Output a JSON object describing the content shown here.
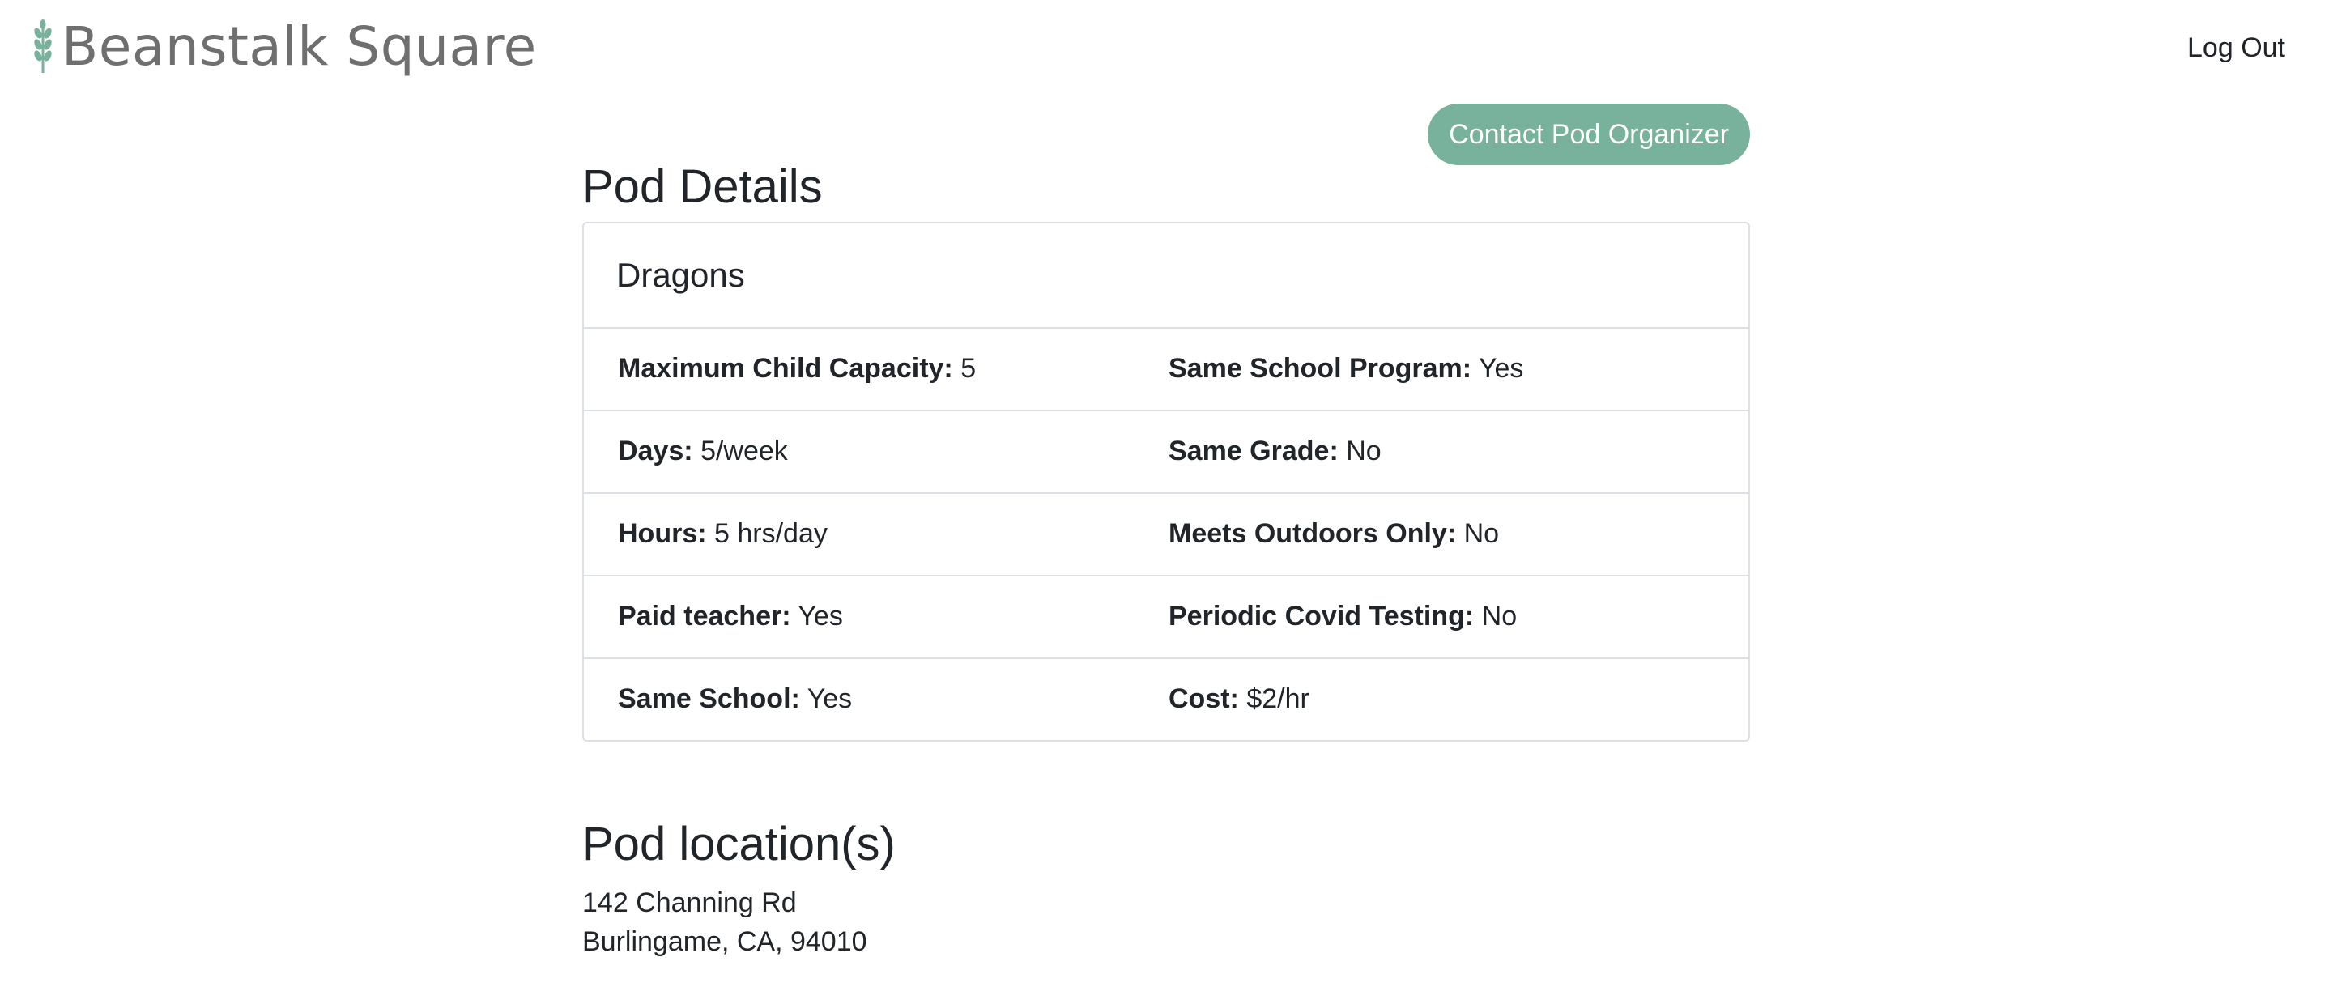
{
  "header": {
    "brand": "Beanstalk Square",
    "logout_label": "Log Out"
  },
  "actions": {
    "contact_label": "Contact Pod Organizer"
  },
  "pod_details": {
    "title": "Pod Details",
    "pod_name": "Dragons",
    "rows": [
      {
        "left": {
          "label": "Maximum Child Capacity:",
          "value": "5"
        },
        "right": {
          "label": "Same School Program:",
          "value": "Yes"
        }
      },
      {
        "left": {
          "label": "Days:",
          "value": "5/week"
        },
        "right": {
          "label": "Same Grade:",
          "value": "No"
        }
      },
      {
        "left": {
          "label": "Hours:",
          "value": "5 hrs/day"
        },
        "right": {
          "label": "Meets Outdoors Only:",
          "value": "No"
        }
      },
      {
        "left": {
          "label": "Paid teacher:",
          "value": "Yes"
        },
        "right": {
          "label": "Periodic Covid Testing:",
          "value": "No"
        }
      },
      {
        "left": {
          "label": "Same School:",
          "value": "Yes"
        },
        "right": {
          "label": "Cost:",
          "value": "$2/hr"
        }
      }
    ]
  },
  "location": {
    "title": "Pod location(s)",
    "address_line1": "142 Channing Rd",
    "address_line2": "Burlingame, CA, 94010"
  },
  "colors": {
    "accent": "#78b29c",
    "logo_text": "#6f6f6f",
    "border": "#dcdfe3"
  },
  "icons": {
    "logo": "wheat-sprout-icon"
  }
}
